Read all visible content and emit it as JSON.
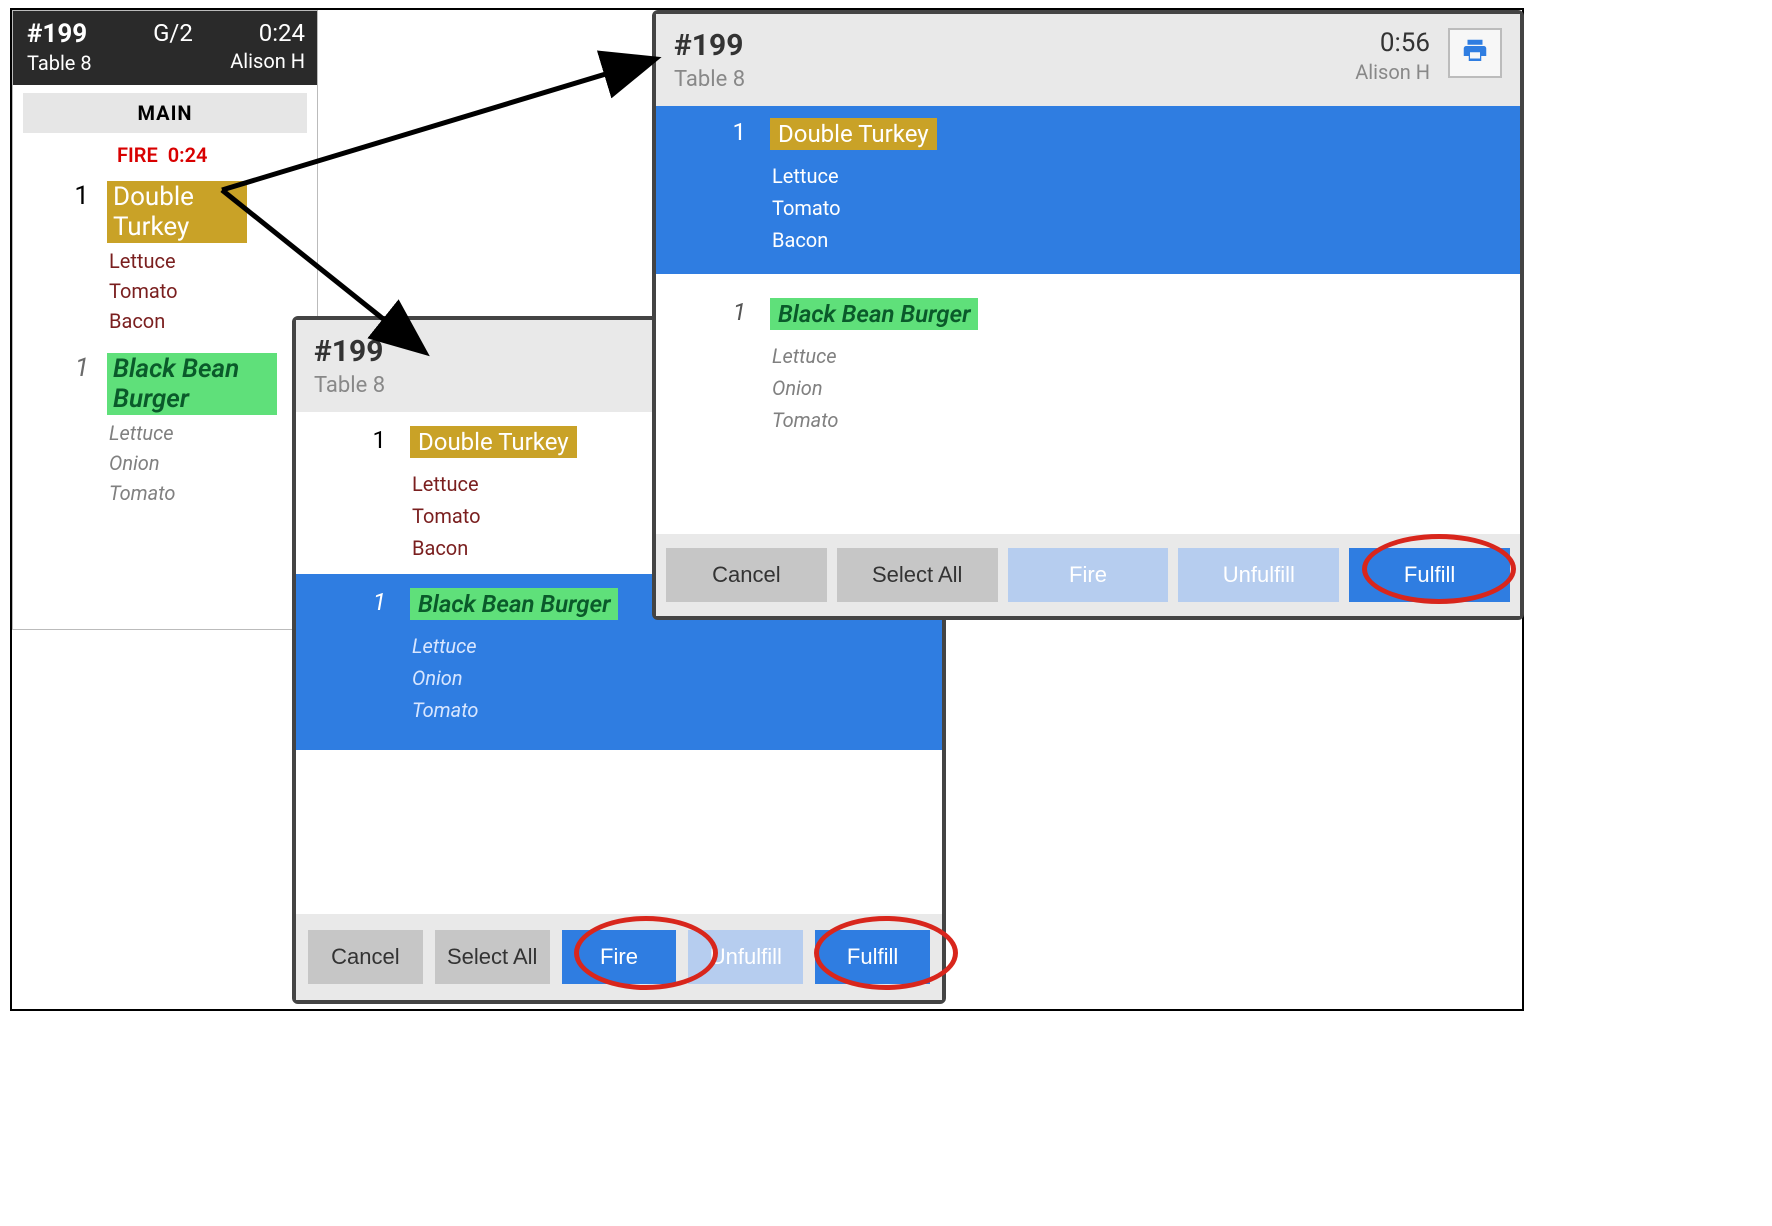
{
  "ticket_small": {
    "order_no": "#199",
    "guest_zone": "G/2",
    "timer": "0:24",
    "table": "Table 8",
    "server": "Alison H",
    "section": "MAIN",
    "fire_prefix": "FIRE",
    "fire_timer": "0:24",
    "items": [
      {
        "qty": "1",
        "name": "Double Turkey",
        "highlight": "gold",
        "mods": [
          "Lettuce",
          "Tomato",
          "Bacon"
        ],
        "mod_style": "red"
      },
      {
        "qty": "1",
        "name": "Black Bean Burger",
        "highlight": "green",
        "qty_style": "italic-grey",
        "mods": [
          "Lettuce",
          "Onion",
          "Tomato"
        ],
        "mod_style": "grey"
      }
    ]
  },
  "panel_mid": {
    "order_no": "#199",
    "table": "Table 8",
    "items": [
      {
        "qty": "1",
        "name": "Double Turkey",
        "highlight": "gold",
        "selected": false,
        "mods": [
          "Lettuce",
          "Tomato",
          "Bacon"
        ],
        "mod_style": "red"
      },
      {
        "qty": "1",
        "name": "Black Bean Burger",
        "highlight": "green",
        "selected": true,
        "qty_style": "italic",
        "mods": [
          "Lettuce",
          "Onion",
          "Tomato"
        ],
        "mod_style": "grey"
      }
    ],
    "actions": {
      "cancel": "Cancel",
      "select_all": "Select All",
      "fire": "Fire",
      "unfulfill": "Unfulfill",
      "fulfill": "Fulfill"
    }
  },
  "panel_right": {
    "order_no": "#199",
    "table": "Table 8",
    "timer": "0:56",
    "server": "Alison H",
    "items": [
      {
        "qty": "1",
        "name": "Double Turkey",
        "highlight": "gold",
        "selected": true,
        "mods": [
          "Lettuce",
          "Tomato",
          "Bacon"
        ]
      },
      {
        "qty": "1",
        "name": "Black Bean Burger",
        "highlight": "green",
        "selected": false,
        "qty_style": "italic",
        "mods": [
          "Lettuce",
          "Onion",
          "Tomato"
        ],
        "mod_style": "grey"
      }
    ],
    "actions": {
      "cancel": "Cancel",
      "select_all": "Select All",
      "fire": "Fire",
      "unfulfill": "Unfulfill",
      "fulfill": "Fulfill"
    }
  }
}
